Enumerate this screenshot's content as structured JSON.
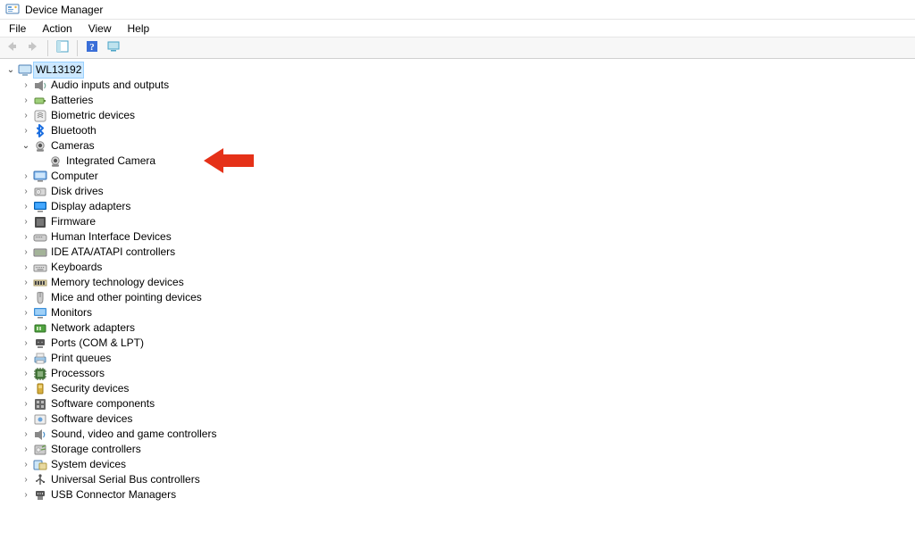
{
  "window": {
    "title": "Device Manager"
  },
  "menu": {
    "file": "File",
    "action": "Action",
    "view": "View",
    "help": "Help"
  },
  "tree": {
    "root": {
      "label": "WL13192",
      "expanded": true,
      "selected": true
    },
    "categories": [
      {
        "label": "Audio inputs and outputs",
        "icon": "audio"
      },
      {
        "label": "Batteries",
        "icon": "battery"
      },
      {
        "label": "Biometric devices",
        "icon": "biometric"
      },
      {
        "label": "Bluetooth",
        "icon": "bluetooth"
      },
      {
        "label": "Cameras",
        "icon": "camera",
        "expanded": true,
        "children": [
          {
            "label": "Integrated Camera",
            "icon": "camera"
          }
        ]
      },
      {
        "label": "Computer",
        "icon": "computer"
      },
      {
        "label": "Disk drives",
        "icon": "disk"
      },
      {
        "label": "Display adapters",
        "icon": "display"
      },
      {
        "label": "Firmware",
        "icon": "firmware"
      },
      {
        "label": "Human Interface Devices",
        "icon": "hid"
      },
      {
        "label": "IDE ATA/ATAPI controllers",
        "icon": "ide"
      },
      {
        "label": "Keyboards",
        "icon": "keyboard"
      },
      {
        "label": "Memory technology devices",
        "icon": "memory"
      },
      {
        "label": "Mice and other pointing devices",
        "icon": "mouse"
      },
      {
        "label": "Monitors",
        "icon": "monitor"
      },
      {
        "label": "Network adapters",
        "icon": "network"
      },
      {
        "label": "Ports (COM & LPT)",
        "icon": "port"
      },
      {
        "label": "Print queues",
        "icon": "printer"
      },
      {
        "label": "Processors",
        "icon": "cpu"
      },
      {
        "label": "Security devices",
        "icon": "security"
      },
      {
        "label": "Software components",
        "icon": "swcomp"
      },
      {
        "label": "Software devices",
        "icon": "swdev"
      },
      {
        "label": "Sound, video and game controllers",
        "icon": "sound"
      },
      {
        "label": "Storage controllers",
        "icon": "storage"
      },
      {
        "label": "System devices",
        "icon": "system"
      },
      {
        "label": "Universal Serial Bus controllers",
        "icon": "usb"
      },
      {
        "label": "USB Connector Managers",
        "icon": "usbconn"
      }
    ]
  },
  "annotation": {
    "type": "arrow-left",
    "color": "#E53118",
    "points_at": "Integrated Camera"
  },
  "colors": {
    "selection_bg": "#cce8ff",
    "selection_border": "#99d1ff"
  }
}
